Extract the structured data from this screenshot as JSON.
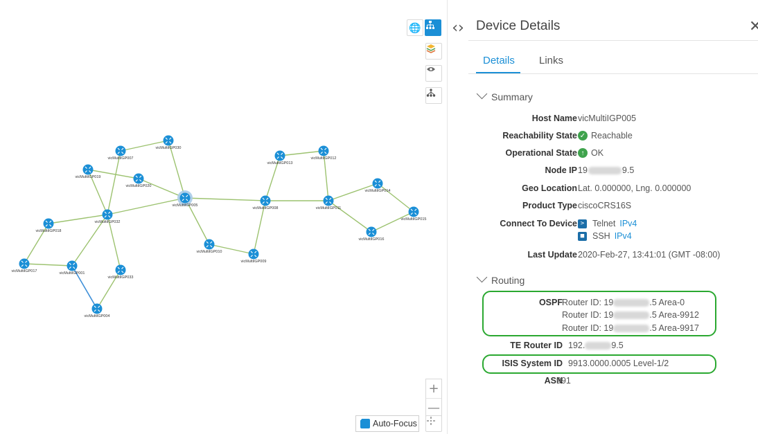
{
  "topology": {
    "nodes": [
      {
        "id": "n007",
        "label": "vicMultiIGP007"
      },
      {
        "id": "n030",
        "label": "vicMultiIGP030"
      },
      {
        "id": "n019",
        "label": "vicMultiIGP019"
      },
      {
        "id": "n020",
        "label": "vicMultiIGP020"
      },
      {
        "id": "n005",
        "label": "vicMultiIGP005"
      },
      {
        "id": "n032",
        "label": "vicMultiIGP032"
      },
      {
        "id": "n018",
        "label": "vicMultiIGP018"
      },
      {
        "id": "n017",
        "label": "vicMultiIGP017"
      },
      {
        "id": "n001",
        "label": "vicMultiIGP001"
      },
      {
        "id": "n033",
        "label": "vicMultiIGP033"
      },
      {
        "id": "n004",
        "label": "vicMultiIGP004"
      },
      {
        "id": "n010",
        "label": "vicMultiIGP010"
      },
      {
        "id": "n009",
        "label": "vicMultiIGP009"
      },
      {
        "id": "n008",
        "label": "vicMultiIGP008"
      },
      {
        "id": "n013",
        "label": "vicMultiIGP013"
      },
      {
        "id": "n012",
        "label": "vicMultiIGP012"
      },
      {
        "id": "n011",
        "label": "vicMultiIGP011"
      },
      {
        "id": "n014",
        "label": "vicMultiIGP014"
      },
      {
        "id": "n015",
        "label": "vicMultiIGP015"
      },
      {
        "id": "n016",
        "label": "vicMultiIGP016"
      }
    ],
    "links": [
      [
        "n007",
        "n030"
      ],
      [
        "n007",
        "n032"
      ],
      [
        "n019",
        "n032"
      ],
      [
        "n019",
        "n020"
      ],
      [
        "n020",
        "n005"
      ],
      [
        "n030",
        "n005"
      ],
      [
        "n032",
        "n005"
      ],
      [
        "n032",
        "n018"
      ],
      [
        "n032",
        "n001"
      ],
      [
        "n032",
        "n033"
      ],
      [
        "n018",
        "n017"
      ],
      [
        "n017",
        "n001"
      ],
      [
        "n001",
        "n004",
        "blue"
      ],
      [
        "n033",
        "n004"
      ],
      [
        "n005",
        "n010"
      ],
      [
        "n010",
        "n009"
      ],
      [
        "n009",
        "n008"
      ],
      [
        "n005",
        "n008"
      ],
      [
        "n008",
        "n013"
      ],
      [
        "n008",
        "n011"
      ],
      [
        "n013",
        "n012"
      ],
      [
        "n012",
        "n011"
      ],
      [
        "n011",
        "n014"
      ],
      [
        "n014",
        "n015"
      ],
      [
        "n011",
        "n016"
      ],
      [
        "n016",
        "n015"
      ]
    ],
    "selected_node": "n005",
    "colors": {
      "node": "#1b8fd6",
      "link": "#9cc26f",
      "link_blue": "#3d8fd8",
      "selected_ring": "#a9cbe8"
    }
  },
  "toolbar": {
    "globe_icon": "globe-icon",
    "topology_icon": "topology-icon",
    "layers_icon": "layers-icon",
    "eye_icon": "eye-icon",
    "hierarchy_icon": "hierarchy-icon",
    "zoom_in": "+",
    "zoom_out": "—",
    "auto_focus_label": "Auto-Focus",
    "auto_focus_checked": true
  },
  "panel": {
    "title": "Device Details",
    "close_icon": "close-icon",
    "tabs": [
      {
        "label": "Details",
        "active": true
      },
      {
        "label": "Links",
        "active": false
      }
    ],
    "summary": {
      "heading": "Summary",
      "host_name": {
        "label": "Host Name",
        "value": "vicMultiIGP005"
      },
      "reachability": {
        "label": "Reachability State",
        "value": "Reachable"
      },
      "operational": {
        "label": "Operational State",
        "value": "OK"
      },
      "node_ip": {
        "label": "Node IP",
        "prefix": "19",
        "suffix": "9.5"
      },
      "geo": {
        "label": "Geo Location",
        "value": "Lat. 0.000000, Lng. 0.000000"
      },
      "product": {
        "label": "Product Type",
        "value": "ciscoCRS16S"
      },
      "connect": {
        "label": "Connect To Device",
        "telnet": "Telnet",
        "ssh": "SSH",
        "proto": "IPv4"
      },
      "last_update": {
        "label": "Last Update",
        "value": "2020-Feb-27, 13:41:01 (GMT -08:00)"
      }
    },
    "routing": {
      "heading": "Routing",
      "ospf": {
        "label": "OSPF",
        "entries": [
          {
            "prefix": "Router ID: 19",
            "suffix": ".5 Area-0"
          },
          {
            "prefix": "Router ID: 19",
            "suffix": ".5 Area-9912"
          },
          {
            "prefix": "Router ID: 19",
            "suffix": ".5 Area-9917"
          }
        ]
      },
      "te_router": {
        "label": "TE Router ID",
        "prefix": "192.",
        "suffix": "9.5"
      },
      "isis": {
        "label": "ISIS System ID",
        "value": "9913.0000.0005 Level-1/2"
      },
      "asn": {
        "label": "ASN",
        "value": "991"
      }
    },
    "highlight_color": "#2aa830",
    "accent": "#1b8fd6"
  }
}
